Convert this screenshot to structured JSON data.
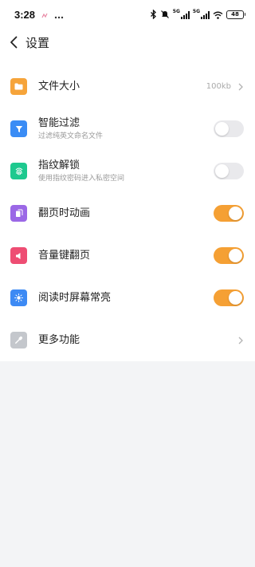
{
  "status_bar": {
    "time": "3:28",
    "network_1": "5G",
    "network_2": "5G",
    "battery": "48"
  },
  "header": {
    "title": "设置"
  },
  "settings": [
    {
      "label": "文件大小",
      "value": "100kb",
      "control": "chevron",
      "icon": "folder-icon",
      "color": "#f6a43a"
    },
    {
      "label": "智能过滤",
      "subtitle": "过滤纯英文命名文件",
      "control": "toggle",
      "enabled": false,
      "icon": "filter-icon",
      "color": "#3a8cf5"
    },
    {
      "label": "指纹解锁",
      "subtitle": "使用指纹密码进入私密空间",
      "control": "toggle",
      "enabled": false,
      "icon": "fingerprint-icon",
      "color": "#1ec98f"
    },
    {
      "label": "翻页时动画",
      "control": "toggle",
      "enabled": true,
      "icon": "page-flip-icon",
      "color": "#9b68e6"
    },
    {
      "label": "音量键翻页",
      "control": "toggle",
      "enabled": true,
      "icon": "volume-icon",
      "color": "#ee4d73"
    },
    {
      "label": "阅读时屏幕常亮",
      "control": "toggle",
      "enabled": true,
      "icon": "brightness-icon",
      "color": "#3d8af4"
    },
    {
      "label": "更多功能",
      "control": "chevron",
      "icon": "wrench-icon",
      "color": "#c4c7cc"
    }
  ],
  "colors": {
    "toggle_on": "#f5a034",
    "toggle_off": "#e9e9ec",
    "background": "#f3f4f6"
  }
}
